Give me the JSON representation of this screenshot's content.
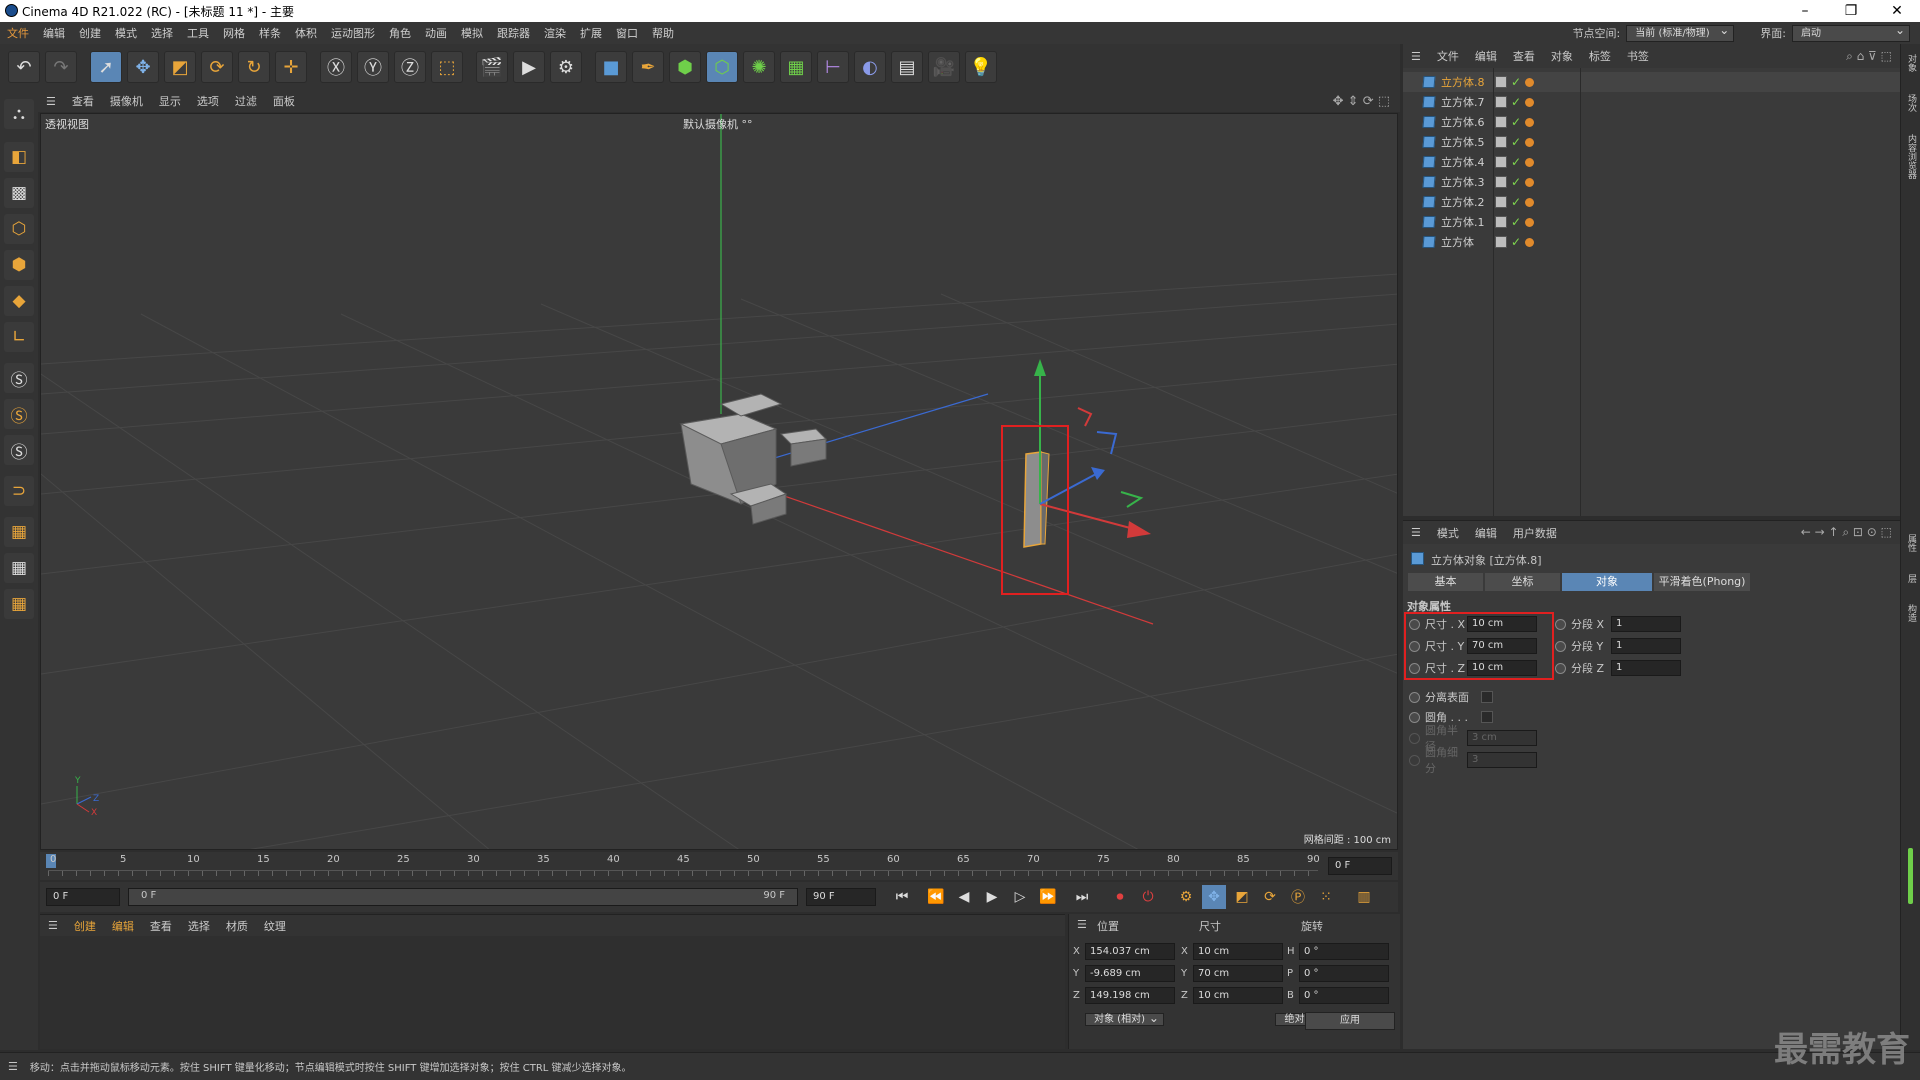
{
  "window": {
    "title": "Cinema 4D R21.022 (RC) - [未标题 11 *] - 主要",
    "controls": [
      "–",
      "❐",
      "✕"
    ]
  },
  "menubar": {
    "items": [
      "文件",
      "编辑",
      "创建",
      "模式",
      "选择",
      "工具",
      "网格",
      "样条",
      "体积",
      "运动图形",
      "角色",
      "动画",
      "模拟",
      "跟踪器",
      "渲染",
      "扩展",
      "窗口",
      "帮助"
    ],
    "node_space_label": "节点空间:",
    "node_space_value": "当前 (标准/物理)",
    "layout_label": "界面:",
    "layout_value": "启动"
  },
  "viewport": {
    "menu": [
      "查看",
      "摄像机",
      "显示",
      "选项",
      "过滤",
      "面板"
    ],
    "view_name": "透视视图",
    "camera_label": "默认摄像机 °°",
    "grid_spacing": "网格间距 : 100 cm",
    "axis_labels": {
      "y": "Y",
      "z": "Z",
      "x": "X"
    }
  },
  "timeline": {
    "ticks": [
      "0",
      "5",
      "10",
      "15",
      "20",
      "25",
      "30",
      "35",
      "40",
      "45",
      "50",
      "55",
      "60",
      "65",
      "70",
      "75",
      "80",
      "85",
      "90"
    ],
    "current_frame_field": "0 F",
    "start_field": "0 F",
    "range_start": "0 F",
    "range_end": "90 F",
    "end_field": "90 F"
  },
  "material_panel": {
    "menu": [
      "创建",
      "编辑",
      "查看",
      "选择",
      "材质",
      "纹理"
    ]
  },
  "coords_panel": {
    "headers": [
      "位置",
      "尺寸",
      "旋转"
    ],
    "rows": [
      {
        "axis": "X",
        "pos": "154.037 cm",
        "size_axis": "X",
        "size": "10 cm",
        "rot_axis": "H",
        "rot": "0 °"
      },
      {
        "axis": "Y",
        "pos": "-9.689 cm",
        "size_axis": "Y",
        "size": "70 cm",
        "rot_axis": "P",
        "rot": "0 °"
      },
      {
        "axis": "Z",
        "pos": "149.198 cm",
        "size_axis": "Z",
        "size": "10 cm",
        "rot_axis": "B",
        "rot": "0 °"
      }
    ],
    "mode_dropdown": "对象 (相对)",
    "size_dropdown": "绝对尺寸",
    "apply_button": "应用"
  },
  "object_manager": {
    "menu": [
      "文件",
      "编辑",
      "查看",
      "对象",
      "标签",
      "书签"
    ],
    "objects": [
      "立方体.8",
      "立方体.7",
      "立方体.6",
      "立方体.5",
      "立方体.4",
      "立方体.3",
      "立方体.2",
      "立方体.1",
      "立方体"
    ],
    "selected_index": 0
  },
  "attribute_manager": {
    "menu": [
      "模式",
      "编辑",
      "用户数据"
    ],
    "object_title": "立方体对象 [立方体.8]",
    "tabs": [
      "基本",
      "坐标",
      "对象",
      "平滑着色(Phong)"
    ],
    "active_tab": "对象",
    "section_title": "对象属性",
    "size": [
      {
        "label": "尺寸 . X",
        "value": "10 cm"
      },
      {
        "label": "尺寸 . Y",
        "value": "70 cm"
      },
      {
        "label": "尺寸 . Z",
        "value": "10 cm"
      }
    ],
    "segments": [
      {
        "label": "分段 X",
        "value": "1"
      },
      {
        "label": "分段 Y",
        "value": "1"
      },
      {
        "label": "分段 Z",
        "value": "1"
      }
    ],
    "separate_surfaces": "分离表面",
    "fillet": "圆角 . . .",
    "fillet_radius_label": "圆角半径",
    "fillet_radius_value": "3 cm",
    "fillet_subdiv_label": "圆角细分",
    "fillet_subdiv_value": "3"
  },
  "right_strip": [
    "对象",
    "场次",
    "内容浏览器",
    "属性",
    "层",
    "构造"
  ],
  "statusbar": {
    "text": "移动：点击并拖动鼠标移动元素。按住 SHIFT 键量化移动；节点编辑模式时按住 SHIFT 键增加选择对象；按住 CTRL 键减少选择对象。"
  },
  "watermark": "最需教育",
  "colors": {
    "accent": "#5a86b5",
    "highlight_frame": "#e02020",
    "selected_name": "#e8a53a",
    "axis_x": "#d23a3a",
    "axis_y": "#37b34a",
    "axis_z": "#3a6ad2"
  }
}
